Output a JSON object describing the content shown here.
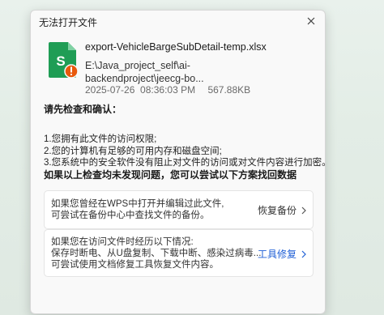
{
  "dialog": {
    "title": "无法打开文件"
  },
  "file": {
    "name": "export-VehicleBargeSubDetail-temp.xlsx",
    "path_line1": "E:\\Java_project_self\\ai-",
    "path_line2": "backendproject\\jeecg-bo...",
    "datetime": "2025-07-26  08:36:03 PM",
    "size": "567.88KB",
    "icon_letter": "S"
  },
  "checks": {
    "title": "请先检查和确认：",
    "items": [
      "1.您拥有此文件的访问权限;",
      "2.您的计算机有足够的可用内存和磁盘空间;",
      "3.您系统中的安全软件没有阻止对文件的访问或对文件内容进行加密。"
    ]
  },
  "recovery": {
    "title": "如果以上检查均未发现问题，您可以尝试以下方案找回数据",
    "backup_card": {
      "line1": "如果您曾经在WPS中打开并编辑过此文件,",
      "line2": "可尝试在备份中心中查找文件的备份。",
      "action": "恢复备份"
    },
    "repair_card": {
      "line1": "如果您在访问文件时经历以下情况:",
      "line2": "保存时断电、从U盘复制、下载中断、感染过病毒...",
      "line3": "可尝试使用文档修复工具恢复文件内容。",
      "action": "工具修复"
    }
  },
  "colors": {
    "accent_blue": "#1f5fd6",
    "file_green": "#1f9d55",
    "warning_orange": "#e8590c"
  },
  "icons": {
    "close": "close-icon",
    "file": "spreadsheet-file-icon",
    "warning": "warning-icon",
    "chevron": "chevron-right-icon"
  }
}
